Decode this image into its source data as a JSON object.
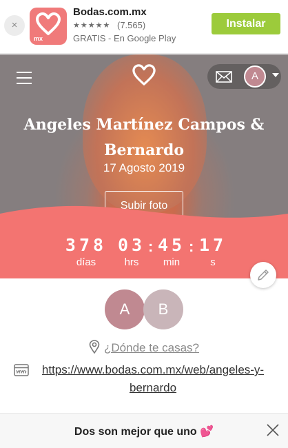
{
  "install_banner": {
    "app_name": "Bodas.com.mx",
    "logo_text": "mx",
    "stars": "★★★★★",
    "rating_count": "(7.565)",
    "subtitle": "GRATIS - En Google Play",
    "install_label": "Instalar",
    "close_glyph": "×"
  },
  "header": {
    "avatar_initial": "A"
  },
  "hero": {
    "couple_names": "Angeles Martínez Campos & Bernardo",
    "date": "17 Agosto 2019",
    "upload_label": "Subir foto"
  },
  "countdown": {
    "days": "378",
    "days_label": "días",
    "hours": "03",
    "hours_label": "hrs",
    "minutes": "45",
    "minutes_label": "min",
    "seconds": "17",
    "seconds_label": "s",
    "separator": ":"
  },
  "profile": {
    "avatar_a": "A",
    "avatar_b": "B",
    "location_link": "¿Dónde te casas?",
    "website_url": "https://www.bodas.com.mx/web/angeles-y-bernardo"
  },
  "footer": {
    "message": "Dos son mejor que uno",
    "heart": "💕"
  },
  "colors": {
    "brand_coral": "#f07a7a",
    "install_green": "#9ccb3b",
    "avatar_a": "#c08991",
    "avatar_b": "#c9b5b9"
  }
}
